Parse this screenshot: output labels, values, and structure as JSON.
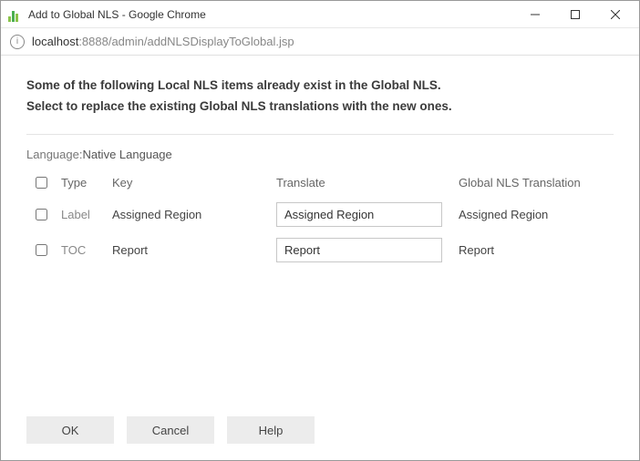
{
  "window": {
    "title": "Add to Global NLS - Google Chrome"
  },
  "address": {
    "host": "localhost",
    "rest": ":8888/admin/addNLSDisplayToGlobal.jsp"
  },
  "intro": {
    "line1": "Some of the following Local NLS items already exist in the Global NLS.",
    "line2": "Select to replace the existing Global NLS translations with the new ones."
  },
  "language": {
    "label": "Language:",
    "value": "Native Language"
  },
  "headers": {
    "type": "Type",
    "key": "Key",
    "translate": "Translate",
    "global": "Global NLS Translation"
  },
  "rows": [
    {
      "type": "Label",
      "key": "Assigned Region",
      "translate": "Assigned Region",
      "global": "Assigned Region"
    },
    {
      "type": "TOC",
      "key": "Report",
      "translate": "Report",
      "global": "Report"
    }
  ],
  "buttons": {
    "ok": "OK",
    "cancel": "Cancel",
    "help": "Help"
  }
}
